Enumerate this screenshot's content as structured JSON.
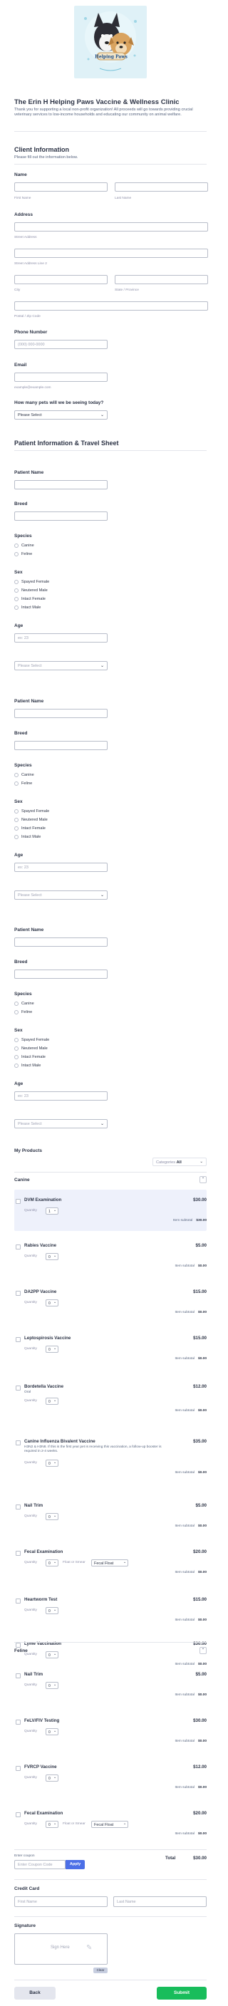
{
  "header": {
    "title": "The Erin H Helping Paws Vaccine & Wellness Clinic",
    "description": "Thank you for supporting a local non-profit organization! All proceeds will go towards providing crucial veterinary services to low-income households and educating our community on animal welfare.",
    "logo_text": "Helping Paws"
  },
  "client": {
    "heading": "Client Information",
    "subheading": "Please fill out the information below.",
    "name_label": "Name",
    "first_sub": "First Name",
    "last_sub": "Last Name",
    "address_label": "Address",
    "street_sub": "Street Address",
    "street2_sub": "Street Address Line 2",
    "city_sub": "City",
    "state_sub": "State / Province",
    "zip_sub": "Postal / Zip Code",
    "phone_label": "Phone Number",
    "phone_placeholder": "(000) 000-0000",
    "email_label": "Email",
    "email_sub": "example@example.com",
    "pets_label": "How many pets will we be seeing today?",
    "pets_value": "Please Select"
  },
  "patient": {
    "heading": "Patient Information & Travel Sheet",
    "name_label": "Patient Name",
    "breed_label": "Breed",
    "species_label": "Species",
    "species_options": [
      "Canine",
      "Feline"
    ],
    "sex_label": "Sex",
    "sex_options": [
      "Spayed Female",
      "Neutered Male",
      "Intact Female",
      "Intact Male"
    ],
    "age_label": "Age",
    "age_placeholder": "ex: 23",
    "select_placeholder": "Please Select"
  },
  "products": {
    "label": "My Products",
    "category_label": "Categories",
    "category_value": "All",
    "quantity_label": "Quantity",
    "subtotal_label": "Item subtotal",
    "canine": {
      "title": "Canine",
      "items": [
        {
          "name": "DVM Examination",
          "price": "$30.00",
          "qty": "1",
          "subtotal": "$30.00"
        },
        {
          "name": "Rabies Vaccine",
          "price": "$5.00",
          "qty": "0",
          "subtotal": "$0.00"
        },
        {
          "name": "DA2PP Vaccine",
          "price": "$15.00",
          "qty": "0",
          "subtotal": "$0.00"
        },
        {
          "name": "Leptospirosis Vaccine",
          "price": "$15.00",
          "qty": "0",
          "subtotal": "$0.00"
        },
        {
          "name": "Bordetella Vaccine",
          "price": "$12.00",
          "note": "Oral",
          "qty": "0",
          "subtotal": "$0.00"
        },
        {
          "name": "Canine Influenza Bivalent Vaccine",
          "price": "$35.00",
          "note": "H3N2 & H3N8. If this is the first year pet is receiving this vaccination, a follow-up booster is required in 2-4 weeks.",
          "qty": "0",
          "subtotal": "$0.00"
        },
        {
          "name": "Nail Trim",
          "price": "$5.00",
          "qty": "0",
          "subtotal": "$0.00"
        },
        {
          "name": "Fecal Examination",
          "price": "$20.00",
          "qty": "0",
          "extra_label": "Float or Smear",
          "extra_value": "Fecal Float",
          "subtotal": "$0.00"
        },
        {
          "name": "Heartworm Test",
          "price": "$15.00",
          "qty": "0",
          "subtotal": "$0.00"
        },
        {
          "name": "Lyme Vaccination",
          "price": "$30.00",
          "qty": "0",
          "subtotal": "$0.00"
        }
      ]
    },
    "feline": {
      "title": "Feline",
      "items": [
        {
          "name": "Nail Trim",
          "price": "$5.00",
          "qty": "0",
          "subtotal": "$0.00"
        },
        {
          "name": "FeLV/FIV Testing",
          "price": "$30.00",
          "qty": "0",
          "subtotal": "$0.00"
        },
        {
          "name": "FVRCP Vaccine",
          "price": "$12.00",
          "qty": "0",
          "subtotal": "$0.00"
        },
        {
          "name": "Fecal Examination",
          "price": "$20.00",
          "qty": "0",
          "extra_label": "Float or Smear",
          "extra_value": "Fecal Float",
          "subtotal": "$0.00"
        }
      ]
    },
    "coupon_label": "Enter coupon",
    "coupon_placeholder": "Enter Coupon Code",
    "apply_label": "Apply",
    "total_label": "Total",
    "total_value": "$30.00"
  },
  "credit": {
    "heading": "Credit Card",
    "first_placeholder": "First Name",
    "last_placeholder": "Last Name"
  },
  "signature": {
    "label": "Signature",
    "hint": "Sign Here",
    "clear_label": "Clear"
  },
  "footer": {
    "back_label": "Back",
    "submit_label": "Submit"
  },
  "colors": {
    "accent": "#4c6fe7",
    "submit": "#18bd5b",
    "selected_row": "#eef1fb"
  }
}
